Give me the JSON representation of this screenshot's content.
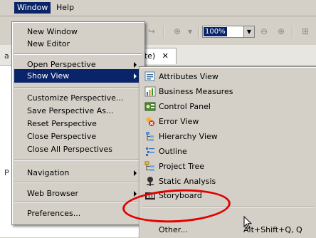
{
  "menubar": {
    "items": [
      "Window",
      "Help"
    ]
  },
  "toolbar": {
    "zoom": "100%"
  },
  "editor": {
    "tab_label": "late)",
    "bg_text_top": "a",
    "bg_text_bottom": "P"
  },
  "window_menu": {
    "items": [
      {
        "label": "New Window"
      },
      {
        "label": "New Editor"
      },
      {
        "label": "Open Perspective",
        "submenu": true
      },
      {
        "label": "Show View",
        "submenu": true,
        "selected": true
      },
      {
        "label": "Customize Perspective..."
      },
      {
        "label": "Save Perspective As..."
      },
      {
        "label": "Reset Perspective"
      },
      {
        "label": "Close Perspective"
      },
      {
        "label": "Close All Perspectives"
      },
      {
        "label": "Navigation",
        "submenu": true
      },
      {
        "label": "Web Browser",
        "submenu": true
      },
      {
        "label": "Preferences..."
      }
    ]
  },
  "show_view_menu": {
    "items": [
      {
        "label": "Attributes View",
        "icon": "attributes-view-icon"
      },
      {
        "label": "Business Measures",
        "icon": "business-measures-icon"
      },
      {
        "label": "Control Panel",
        "icon": "control-panel-icon"
      },
      {
        "label": "Error View",
        "icon": "error-view-icon"
      },
      {
        "label": "Hierarchy View",
        "icon": "hierarchy-view-icon"
      },
      {
        "label": "Outline",
        "icon": "outline-icon"
      },
      {
        "label": "Project Tree",
        "icon": "project-tree-icon"
      },
      {
        "label": "Static Analysis",
        "icon": "static-analysis-icon"
      },
      {
        "label": "Storyboard",
        "icon": "storyboard-icon"
      },
      {
        "label": "Other...",
        "accelerator": "Alt+Shift+Q, Q"
      }
    ]
  },
  "colors": {
    "menu_bg": "#d4d0c8",
    "selection": "#0a246a",
    "highlight_ring": "#e30000"
  }
}
